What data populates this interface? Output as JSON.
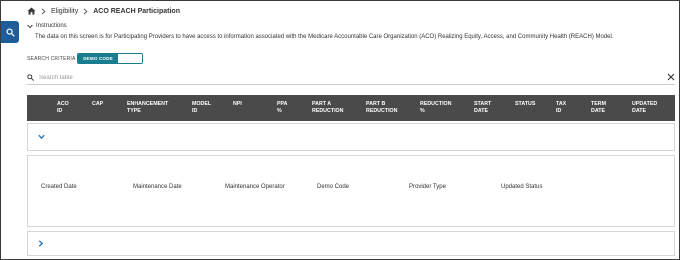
{
  "breadcrumb": {
    "items": [
      {
        "label": "Eligibility"
      },
      {
        "label": "ACO REACH Participation"
      }
    ]
  },
  "instructions": {
    "toggle_label": "Instructions",
    "text": "The data on this screen is for Participating Providers to have access to information associated with the Medicare Accountable Care Organization (ACO) Realizing Equity, Access, and Community Health (REACH) Model."
  },
  "search_criteria": {
    "label": "SEARCH CRITERIA",
    "active_option": "DEMO CODE"
  },
  "search": {
    "placeholder": "Search table"
  },
  "table": {
    "columns": [
      "ACO\nID",
      "CAP",
      "ENHANCEMENT\nTYPE",
      "MODEL\nID",
      "NPI",
      "PPA\n%",
      "PART A\nREDUCTION",
      "PART B\nREDUCTION",
      "REDUCTION\n%",
      "START\nDATE",
      "STATUS",
      "TAX\nID",
      "TERM\nDATE",
      "UPDATED\nDATE"
    ],
    "detail_fields": [
      "Created Date",
      "Maintenance Date",
      "Maintenance Operator",
      "Demo Code",
      "Provider Type",
      "Updated Status"
    ]
  },
  "colors": {
    "side_tab": "#1f5c99",
    "toggle_accent": "#1a7d8f",
    "header_bg": "#4a4a4a",
    "chevron": "#1f6fb5"
  },
  "icons": {
    "side_tab": "search-icon",
    "home": "home-icon",
    "breadcrumb_separator": "chevron-right-icon",
    "instructions": "chevron-down-icon",
    "search": "search-icon",
    "clear": "close-icon",
    "row_expanded": "chevron-down-icon",
    "row_collapsed": "chevron-right-icon"
  }
}
